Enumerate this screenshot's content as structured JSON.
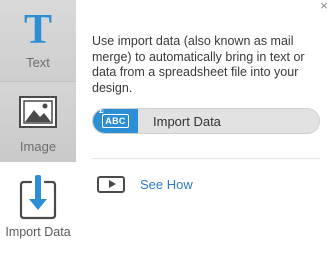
{
  "sidebar": {
    "tools": [
      {
        "label": "Text",
        "icon": "text-T-icon"
      },
      {
        "label": "Image",
        "icon": "image-icon"
      },
      {
        "label": "Import Data",
        "icon": "import-data-icon"
      }
    ],
    "active_tool": "Import Data"
  },
  "panel": {
    "close_glyph": "×",
    "description": "Use import data (also known as mail merge) to automatically bring in text or data from a spreadsheet file into your design.",
    "import_button": {
      "label": "Import Data",
      "icon_text": "ABC",
      "icon_symbol": "£"
    },
    "see_how": {
      "label": "See How",
      "icon": "video-play-icon"
    }
  },
  "colors": {
    "accent": "#2d8fd3",
    "link": "#2d7bc4",
    "sidebar_bg": "#d3d3d3"
  }
}
